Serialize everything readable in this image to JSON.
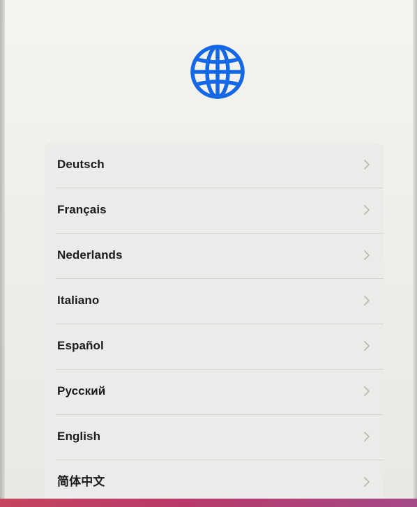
{
  "header": {
    "icon": "globe-icon",
    "accent": "#1468e6"
  },
  "languages": [
    {
      "label": "Deutsch"
    },
    {
      "label": "Français"
    },
    {
      "label": "Nederlands"
    },
    {
      "label": "Italiano"
    },
    {
      "label": "Español"
    },
    {
      "label": "Русский"
    },
    {
      "label": "English"
    },
    {
      "label": "简体中文"
    }
  ],
  "chevron_icon": "chevron-right-icon"
}
